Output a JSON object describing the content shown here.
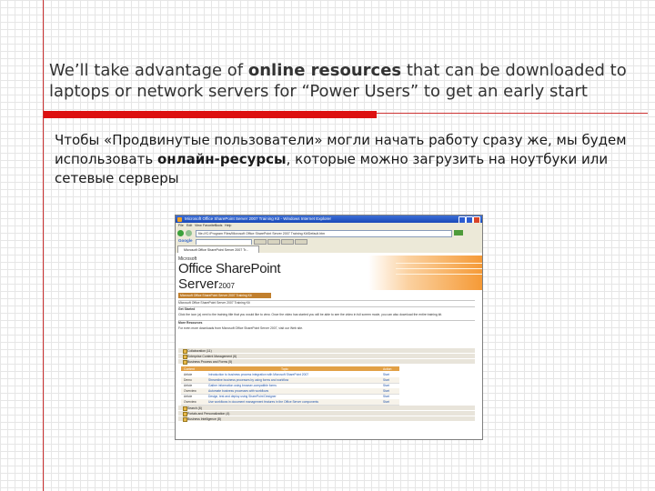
{
  "slide": {
    "title_parts": [
      {
        "text": "We’ll take advantage of ",
        "bold": false
      },
      {
        "text": "online resources",
        "bold": true
      },
      {
        "text": " that can be downloaded to laptops or network servers for “Power Users” to get an early start",
        "bold": false
      }
    ],
    "subtitle_parts": [
      {
        "text": "Чтобы «Продвинутые пользователи» могли начать работу сразу же, мы будем использовать ",
        "bold": false
      },
      {
        "text": "онлайн-ресурсы",
        "bold": true
      },
      {
        "text": ", которые можно загрузить на ноутбуки или сетевые серверы",
        "bold": false
      }
    ],
    "colors": {
      "accent": "#dd1111",
      "grid": "#e6e6e6",
      "margin_line": "#cc3333"
    }
  },
  "browser": {
    "window_title": "Microsoft Office SharePoint Server 2007 Training Kit - Windows Internet Explorer",
    "menu": [
      "File",
      "Edit",
      "View",
      "Favorites",
      "Tools",
      "Help"
    ],
    "address": "file:///C:/Program Files/Microsoft Office SharePoint Server 2007 Training Kit/Default.htm",
    "search_brand": "Google",
    "tab_label": "Microsoft Office SharePoint Server 2007 Tr...",
    "page": {
      "logo_company": "Microsoft",
      "logo_product": "Office SharePoint",
      "logo_server": "Server",
      "logo_year": "2007",
      "header_strip": "Microsoft Office SharePoint Server 2007 Training Kit",
      "intro_line": "Microsoft Office SharePoint Server 2007 Training Kit",
      "get_started_heading": "Get Started",
      "get_started_text": "Click the icon (a) next to the training title that you would like to view. Once the video has started you will be able to see the video in full screen mode, you can also download the entire training kit.",
      "more_resources_heading": "More Resources",
      "more_resources_text": "For even more downloads from Microsoft Office SharePoint Server 2007, visit our Web site.",
      "sections": [
        "Collaboration (11)",
        "Enterprise Content Management (6)",
        "Business Process and Forms (5)"
      ],
      "table_headers": [
        "Content",
        "Topic",
        "Action"
      ],
      "table_rows": [
        {
          "content": "Article",
          "topic": "Introduction to business process integration with Microsoft SharePoint 2007",
          "action": "Start"
        },
        {
          "content": "Demo",
          "topic": "Streamline business processes by using forms and workflow",
          "action": "Start"
        },
        {
          "content": "Article",
          "topic": "Gather information using browser-compatible forms",
          "action": "Start"
        },
        {
          "content": "Overview",
          "topic": "Automate business processes with workflows",
          "action": "Start"
        },
        {
          "content": "Article",
          "topic": "Design, test and deploy using SharePoint Designer",
          "action": "Start"
        },
        {
          "content": "Overview",
          "topic": "Use workflows in document management features in the Office Server components",
          "action": "Start"
        }
      ],
      "more_sections": [
        "Search (6)",
        "Portals and Personalization (4)",
        "Business Intelligence (8)"
      ]
    }
  }
}
